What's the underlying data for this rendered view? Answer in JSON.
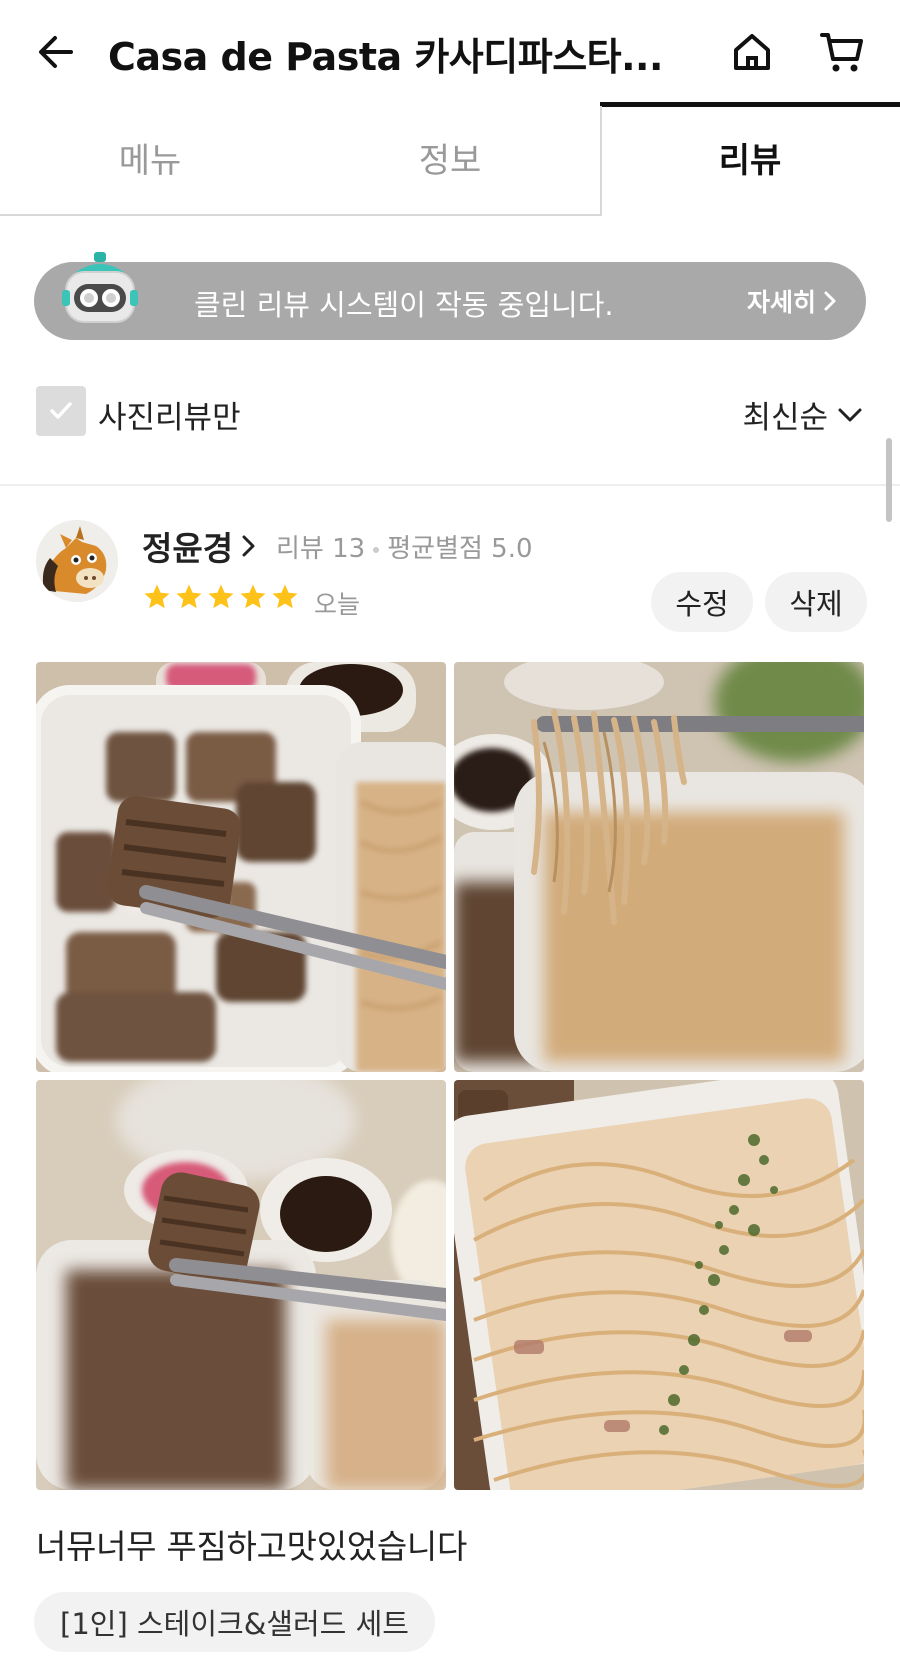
{
  "header": {
    "title": "Casa de Pasta 카사디파스타...",
    "back_icon": "arrow-left-icon",
    "home_icon": "home-icon",
    "cart_icon": "cart-icon"
  },
  "tabs": [
    {
      "label": "메뉴",
      "active": false
    },
    {
      "label": "정보",
      "active": false
    },
    {
      "label": "리뷰",
      "active": true
    }
  ],
  "banner": {
    "text": "클린 리뷰 시스템이 작동 중입니다.",
    "more_label": "자세히"
  },
  "filter": {
    "photo_only_label": "사진리뷰만",
    "photo_only_checked": true,
    "sort_label": "최신순"
  },
  "review": {
    "reviewer_name": "정윤경",
    "review_count_label": "리뷰 13",
    "avg_rating_label": "평균별점 5.0",
    "rating": 5,
    "date": "오늘",
    "edit_label": "수정",
    "delete_label": "삭제",
    "text": "너뮤너무 푸짐하고맛있었습니다",
    "menu_tag": "[1인] 스테이크&샐러드 세트",
    "photo_count": 4
  },
  "colors": {
    "banner_bg": "#a9a9a9",
    "star": "#FFC21A",
    "active_tab": "#111111",
    "inactive_tab": "#999999"
  }
}
